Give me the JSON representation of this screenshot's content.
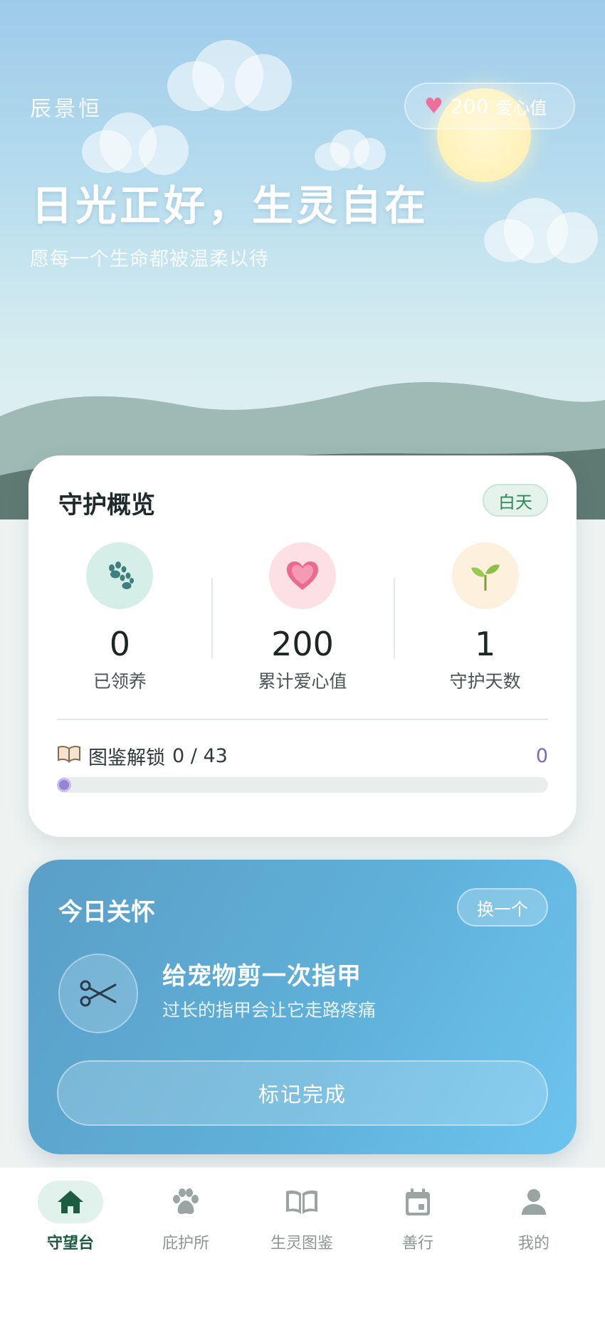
{
  "hero": {
    "user_name": "辰景恒",
    "love_value": "200",
    "love_unit": "爱心值",
    "title": "日光正好，生灵自在",
    "subtitle": "愿每一个生命都被温柔以待"
  },
  "overview": {
    "title": "守护概览",
    "period_badge": "白天",
    "stats": [
      {
        "value": "0",
        "label": "已领养",
        "icon": "paw-icon"
      },
      {
        "value": "200",
        "label": "累计爱心值",
        "icon": "heart-icon"
      },
      {
        "value": "1",
        "label": "守护天数",
        "icon": "sprout-icon"
      }
    ],
    "unlock": {
      "label": "图鉴解锁",
      "count": "0 / 43",
      "right_value": "0",
      "progress": 0
    }
  },
  "care": {
    "title": "今日关怀",
    "switch_label": "换一个",
    "task": "给宠物剪一次指甲",
    "description": "过长的指甲会让它走路疼痛",
    "done_label": "标记完成",
    "icon": "scissors-icon"
  },
  "nav": {
    "items": [
      {
        "label": "守望台",
        "icon": "home-icon",
        "active": true
      },
      {
        "label": "庇护所",
        "icon": "paw-icon",
        "active": false
      },
      {
        "label": "生灵图鉴",
        "icon": "book-icon",
        "active": false
      },
      {
        "label": "善行",
        "icon": "calendar-icon",
        "active": false
      },
      {
        "label": "我的",
        "icon": "person-icon",
        "active": false
      }
    ]
  },
  "colors": {
    "accent_green": "#1d5c42",
    "love_pink": "#ea5a86",
    "progress_purple": "#9882d6",
    "care_blue": "#5fb0d9"
  }
}
